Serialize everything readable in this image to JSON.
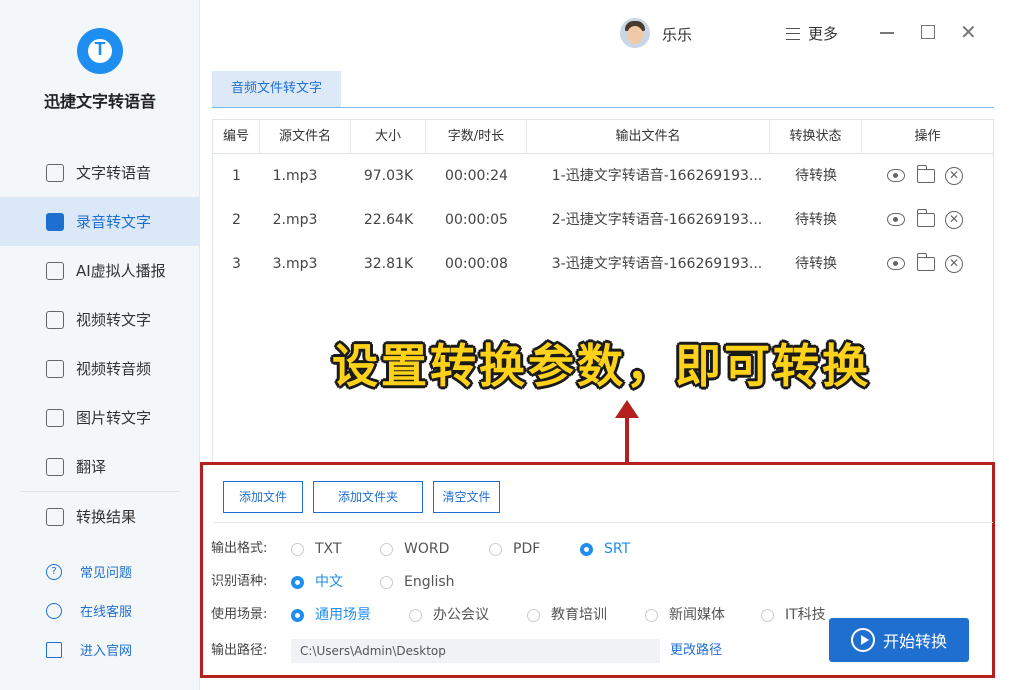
{
  "app": {
    "name": "迅捷文字转语音",
    "logo_letter": "T"
  },
  "sidebar": {
    "items": [
      {
        "label": "文字转语音",
        "icon": "text-to-speech-icon",
        "active": false
      },
      {
        "label": "录音转文字",
        "icon": "audio-to-text-icon",
        "active": true
      },
      {
        "label": "AI虚拟人播报",
        "icon": "ai-avatar-icon",
        "active": false
      },
      {
        "label": "视频转文字",
        "icon": "video-to-text-icon",
        "active": false
      },
      {
        "label": "视频转音频",
        "icon": "video-to-audio-icon",
        "active": false
      },
      {
        "label": "图片转文字",
        "icon": "image-to-text-icon",
        "active": false
      },
      {
        "label": "翻译",
        "icon": "translate-icon",
        "active": false
      },
      {
        "label": "转换结果",
        "icon": "results-icon",
        "active": false
      }
    ],
    "help": [
      {
        "label": "常见问题",
        "icon": "question-icon"
      },
      {
        "label": "在线客服",
        "icon": "headset-icon"
      },
      {
        "label": "进入官网",
        "icon": "monitor-icon"
      }
    ]
  },
  "header": {
    "username": "乐乐",
    "more_label": "更多"
  },
  "tabs": [
    {
      "label": "音频文件转文字",
      "active": true
    }
  ],
  "table": {
    "columns": [
      "编号",
      "源文件名",
      "大小",
      "字数/时长",
      "输出文件名",
      "转换状态",
      "操作"
    ],
    "rows": [
      {
        "no": "1",
        "file": "1.mp3",
        "size": "97.03K",
        "duration": "00:00:24",
        "output": "1-迅捷文字转语音-166269193...",
        "status": "待转换"
      },
      {
        "no": "2",
        "file": "2.mp3",
        "size": "22.64K",
        "duration": "00:00:05",
        "output": "2-迅捷文字转语音-166269193...",
        "status": "待转换"
      },
      {
        "no": "3",
        "file": "3.mp3",
        "size": "32.81K",
        "duration": "00:00:08",
        "output": "3-迅捷文字转语音-166269193...",
        "status": "待转换"
      }
    ]
  },
  "overlay_text": "设置转换参数，即可转换",
  "buttons": {
    "add_file": "添加文件",
    "add_folder": "添加文件夹",
    "clear": "清空文件",
    "start": "开始转换",
    "change_path": "更改路径"
  },
  "settings": {
    "format_label": "输出格式:",
    "formats": [
      {
        "label": "TXT",
        "selected": false
      },
      {
        "label": "WORD",
        "selected": false
      },
      {
        "label": "PDF",
        "selected": false
      },
      {
        "label": "SRT",
        "selected": true
      }
    ],
    "language_label": "识别语种:",
    "languages": [
      {
        "label": "中文",
        "selected": true
      },
      {
        "label": "English",
        "selected": false
      }
    ],
    "scene_label": "使用场景:",
    "scenes": [
      {
        "label": "通用场景",
        "selected": true
      },
      {
        "label": "办公会议",
        "selected": false
      },
      {
        "label": "教育培训",
        "selected": false
      },
      {
        "label": "新闻媒体",
        "selected": false
      },
      {
        "label": "IT科技",
        "selected": false
      }
    ],
    "path_label": "输出路径:",
    "path_value": "C:\\Users\\Admin\\Desktop"
  },
  "colors": {
    "accent": "#1f6fd1",
    "highlight_border": "#b3201f",
    "overlay_text": "#ffd21a"
  }
}
